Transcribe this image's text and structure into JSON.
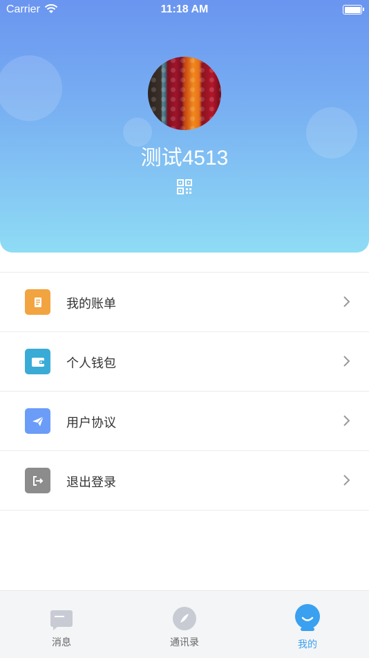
{
  "status_bar": {
    "carrier": "Carrier",
    "time": "11:18 AM"
  },
  "profile": {
    "username": "测试4513"
  },
  "menu": {
    "items": [
      {
        "label": "我的账单",
        "icon": "bill-icon",
        "color": "#f2a440"
      },
      {
        "label": "个人钱包",
        "icon": "wallet-icon",
        "color": "#3aabd6"
      },
      {
        "label": "用户协议",
        "icon": "paper-plane-icon",
        "color": "#6b9cf8"
      },
      {
        "label": "退出登录",
        "icon": "logout-icon",
        "color": "#8c8c8c"
      }
    ]
  },
  "tabbar": {
    "tabs": [
      {
        "label": "消息",
        "icon": "message-icon",
        "active": false
      },
      {
        "label": "通讯录",
        "icon": "compass-icon",
        "active": false
      },
      {
        "label": "我的",
        "icon": "profile-icon",
        "active": true
      }
    ]
  },
  "colors": {
    "accent": "#3aa0f0",
    "header_top": "#6a95f0",
    "header_bottom": "#8fdcf5"
  }
}
